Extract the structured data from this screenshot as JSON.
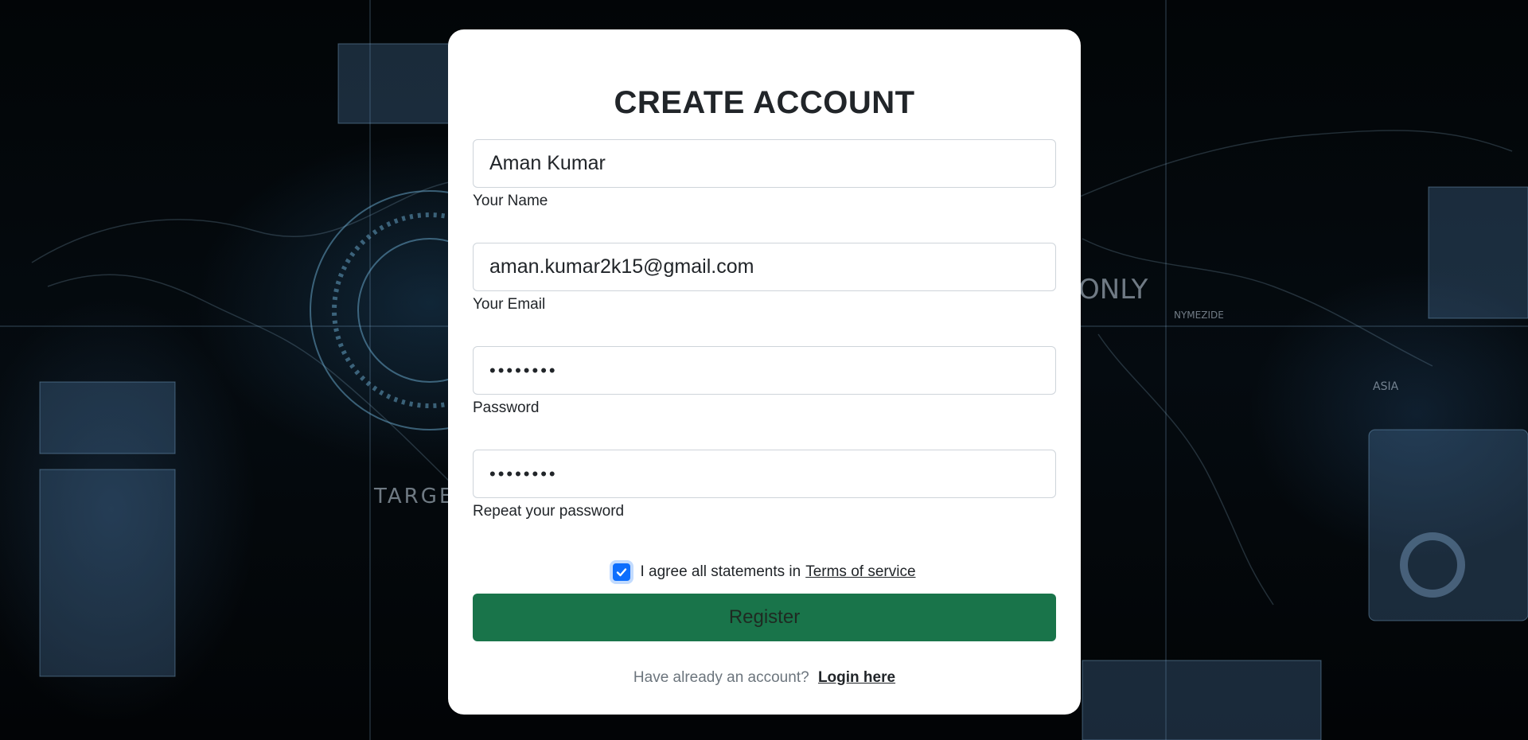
{
  "background": {
    "decor_labels": [
      "ONLY",
      "NYMEZIDE",
      "ASIA",
      "TARGE"
    ]
  },
  "form": {
    "title": "CREATE ACCOUNT",
    "fields": [
      {
        "value": "Aman Kumar",
        "label": "Your Name",
        "type": "text"
      },
      {
        "value": "aman.kumar2k15@gmail.com",
        "label": "Your Email",
        "type": "email"
      },
      {
        "value": "••••••••",
        "label": "Password",
        "type": "password"
      },
      {
        "value": "••••••••",
        "label": "Repeat your password",
        "type": "password"
      }
    ],
    "agree": {
      "checked": true,
      "text": "I agree all statements in",
      "link": "Terms of service"
    },
    "register_label": "Register",
    "login": {
      "text": "Have already an account?",
      "link": "Login here"
    }
  },
  "colors": {
    "card": "#ffffff",
    "register_button": "#19744a",
    "checkbox": "#0d6efd"
  }
}
